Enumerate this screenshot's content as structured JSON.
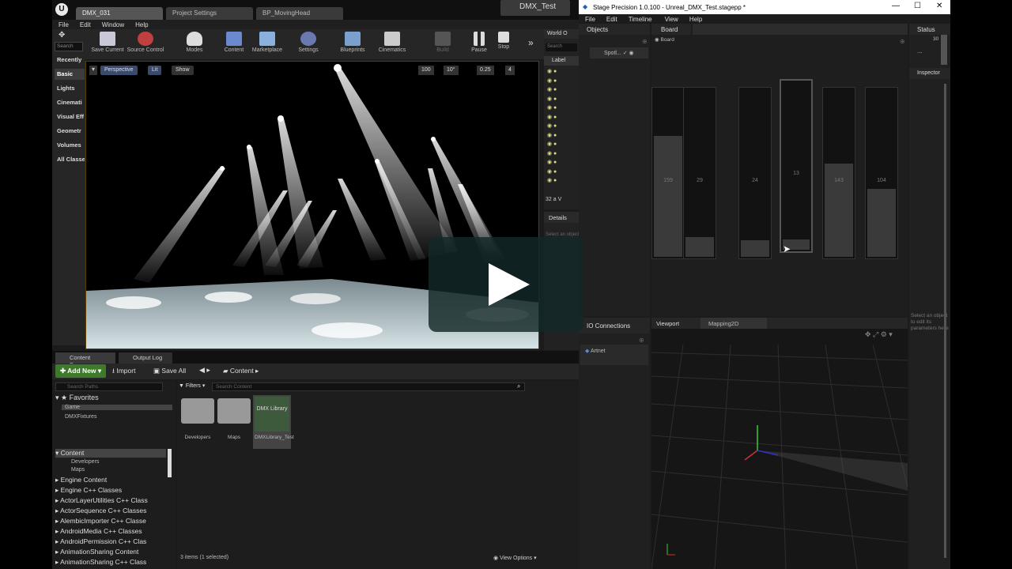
{
  "ue": {
    "tabs": [
      "DMX_031",
      "Project Settings",
      "BP_MovingHead"
    ],
    "title_chip": "DMX_Test",
    "menu": [
      "File",
      "Edit",
      "Window",
      "Help"
    ],
    "toolbar": [
      "Save Current",
      "Source Control",
      "Modes",
      "Content",
      "Marketplace",
      "Settings",
      "Blueprints",
      "Cinematics",
      "Build",
      "Pause",
      "Stop"
    ],
    "left_panel": {
      "search_placeholder": "Search",
      "categories": [
        "Recently",
        "Basic",
        "Lights",
        "Cinemati",
        "Visual Eff",
        "Geometr",
        "Volumes",
        "All Classe"
      ],
      "selected": "Basic"
    },
    "viewport": {
      "perspective": "Perspective",
      "lit": "Lit",
      "show": "Show",
      "grid_snap": "100",
      "rot_snap": "10°",
      "scale_snap": "0.25",
      "cam_speed": "4"
    },
    "outliner": {
      "title": "World O",
      "search_placeholder": "Search",
      "column_label": "Label",
      "count": "32 a",
      "view_label": "V"
    },
    "details_title": "Details",
    "details_hint": "Select an object to view details.",
    "content_browser": {
      "tabs": [
        "Content Browser",
        "Output Log"
      ],
      "add_new": "Add New",
      "import": "Import",
      "save_all": "Save All",
      "path": "Content",
      "search_paths_placeholder": "Search Paths",
      "favorites": "Favorites",
      "favorites_items": [
        "Game",
        "DMXFixtures"
      ],
      "tree": [
        "Content",
        "Developers",
        "Maps",
        "Engine Content",
        "Engine C++ Classes",
        "ActorLayerUtilities C++ Class",
        "ActorSequence C++ Classes",
        "AlembicImporter C++ Classe",
        "AndroidMedia C++ Classes",
        "AndroidPermission C++ Clas",
        "AnimationSharing Content",
        "AnimationSharing C++ Class"
      ],
      "filters": "Filters",
      "search_content_placeholder": "Search Content",
      "assets": [
        {
          "name": "Developers"
        },
        {
          "name": "Maps"
        },
        {
          "name": "DMXLibrary_Test",
          "thumb": "DMX Library"
        }
      ],
      "status": "3 items (1 selected)",
      "view_options": "View Options"
    }
  },
  "sp": {
    "title": "Stage Precision 1.0.100 - Unreal_DMX_Test.stagepp *",
    "menu": [
      "File",
      "Edit",
      "Timeline",
      "View",
      "Help"
    ],
    "objects_title": "Objects",
    "objects_item": "Spotl...",
    "board_title": "Board",
    "board_item": "Board",
    "status_title": "Status",
    "status_value": "30",
    "status_more": "...",
    "inspector_title": "Inspector",
    "inspector_hint": "Select an object to edit its parameters here",
    "faders": [
      {
        "value": "159",
        "level": 0.73
      },
      {
        "value": "29",
        "level": 0.12
      },
      {
        "value": "24",
        "level": 0.1
      },
      {
        "value": "13",
        "level": 0.06
      },
      {
        "value": "143",
        "level": 0.56
      },
      {
        "value": "104",
        "level": 0.41
      }
    ],
    "io_title": "IO Connections",
    "io_item": "Artnet",
    "viewport_tabs": [
      "Viewport",
      "Mapping2D"
    ]
  }
}
